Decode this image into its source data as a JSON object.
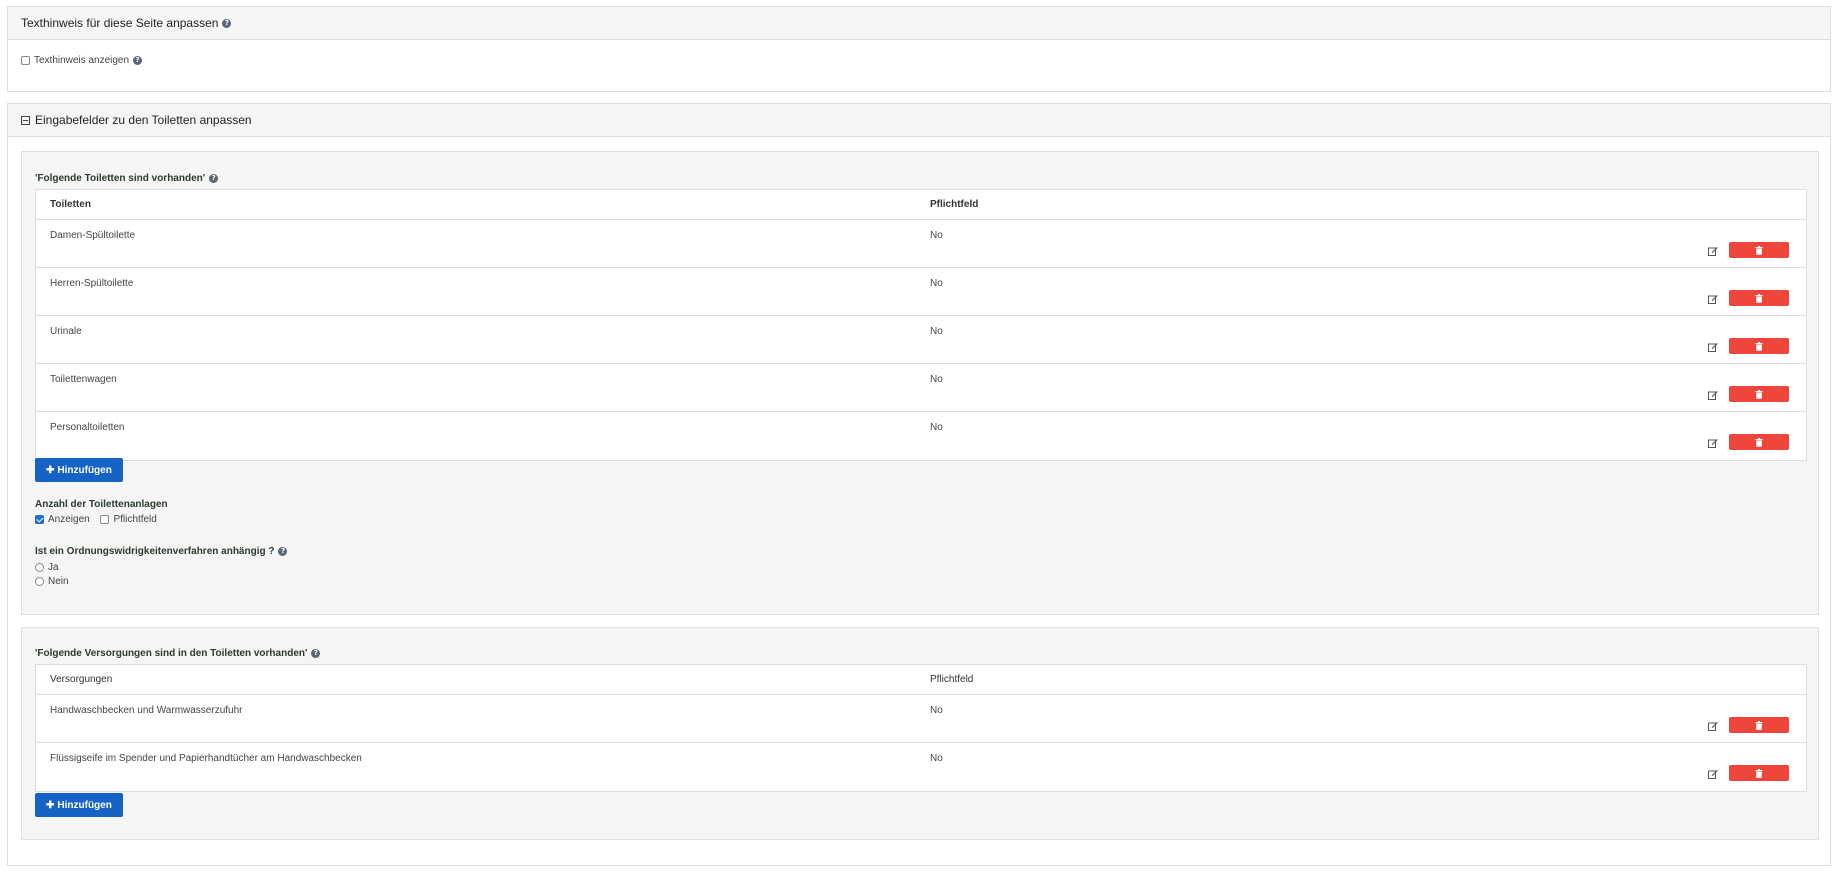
{
  "hint_panel": {
    "title": "Texthinweis für diese Seite anpassen",
    "show_hint_label": "Texthinweis anzeigen",
    "show_hint_checked": false
  },
  "fields_panel": {
    "title": "Eingabefelder zu den Toiletten anpassen",
    "toilets_section": {
      "label": "'Folgende Toiletten sind vorhanden'",
      "headers": {
        "col1": "Toiletten",
        "col2": "Pflichtfeld"
      },
      "rows": [
        {
          "name": "Damen-Spültoilette",
          "required": "No"
        },
        {
          "name": "Herren-Spültoilette",
          "required": "No"
        },
        {
          "name": "Urinale",
          "required": "No"
        },
        {
          "name": "Toilettenwagen",
          "required": "No"
        },
        {
          "name": "Personaltoiletten",
          "required": "No"
        }
      ],
      "add_label": "Hinzufügen",
      "count_label": "Anzahl der Toilettenanlagen",
      "show_label": "Anzeigen",
      "show_checked": true,
      "required_label": "Pflichtfeld",
      "required_checked": false,
      "question_label": "Ist ein Ordnungswidrigkeitenverfahren anhängig ?",
      "option_yes": "Ja",
      "option_no": "Nein"
    },
    "supply_section": {
      "label": "'Folgende Versorgungen sind in den Toiletten vorhanden'",
      "headers": {
        "col1": "Versorgungen",
        "col2": "Pflichtfeld"
      },
      "rows": [
        {
          "name": "Handwaschbecken und Warmwasserzufuhr",
          "required": "No"
        },
        {
          "name": "Flüssigseife im Spender und Papierhandtücher am Handwaschbecken",
          "required": "No"
        }
      ],
      "add_label": "Hinzufügen"
    }
  },
  "colors": {
    "delete": "#f0453a",
    "primary": "#1563c5",
    "panel_heading": "#f5f5f5"
  },
  "icons": {
    "help": "question-circle-icon",
    "edit": "edit-icon",
    "delete": "trash-icon",
    "add": "plus-icon",
    "collapse": "minus-square-icon"
  }
}
